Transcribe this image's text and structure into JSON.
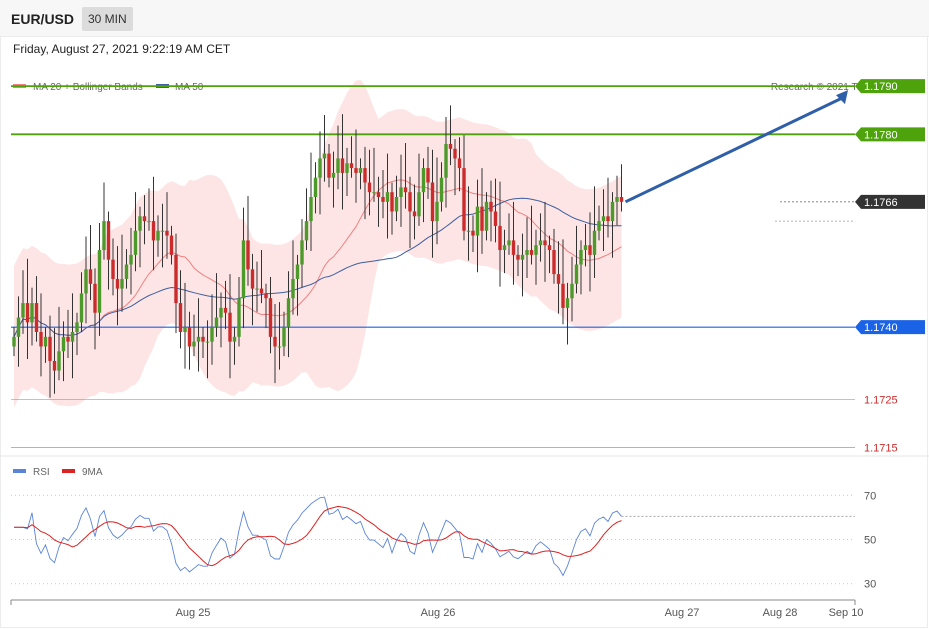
{
  "header": {
    "symbol": "EUR/USD",
    "timeframe": "30 MIN"
  },
  "datetime": "Friday, August 27, 2021 9:22:19 AM CET",
  "legend": {
    "ma20": {
      "label": "MA 20 + Bollinger Bands",
      "color": "#f08080"
    },
    "ma50": {
      "label": "MA 50",
      "color": "#3f5f9f"
    }
  },
  "copyright": "Research © 2021 Trading Central",
  "rsi_legend": {
    "rsi": {
      "label": "RSI",
      "color": "#5b84d8"
    },
    "ma9": {
      "label": "9MA",
      "color": "#dd2222"
    }
  },
  "colors": {
    "up": "#4c9a2a",
    "down": "#cc2b2b",
    "bands": "#fde2e2",
    "target": "#4ea30c",
    "support": "#1a63e6",
    "pivot": "#333333",
    "faint": "#e06060"
  },
  "chart_data": [
    {
      "type": "line",
      "subtype": "candlestick",
      "ylim": [
        1.1711,
        1.1795
      ],
      "x_labels": [
        "Aug 25",
        "Aug 26",
        "Aug 27",
        "Aug 28",
        "Sep 10"
      ],
      "levels": [
        {
          "value": 1.179,
          "label": "1.1790",
          "style": "target"
        },
        {
          "value": 1.178,
          "label": "1.1780",
          "style": "target"
        },
        {
          "value": 1.1766,
          "label": "1.1766",
          "style": "pivot"
        },
        {
          "value": 1.174,
          "label": "1.1740",
          "style": "support"
        },
        {
          "value": 1.1725,
          "label": "1.1725",
          "style": "faint"
        },
        {
          "value": 1.1715,
          "label": "1.1715",
          "style": "faint"
        }
      ],
      "forecast_arrow": {
        "from": 1.1766,
        "to": 1.179
      },
      "closes": [
        1.1738,
        1.1742,
        1.1745,
        1.1741,
        1.1745,
        1.1739,
        1.1736,
        1.1738,
        1.1733,
        1.1731,
        1.1735,
        1.1738,
        1.1737,
        1.1739,
        1.1741,
        1.1747,
        1.1752,
        1.1749,
        1.1743,
        1.1756,
        1.1762,
        1.1754,
        1.175,
        1.1748,
        1.175,
        1.1753,
        1.1755,
        1.176,
        1.1763,
        1.1762,
        1.1762,
        1.1758,
        1.176,
        1.176,
        1.1759,
        1.1755,
        1.1745,
        1.1739,
        1.174,
        1.1736,
        1.1737,
        1.1738,
        1.1737,
        1.1737,
        1.174,
        1.1742,
        1.1744,
        1.1743,
        1.1737,
        1.1738,
        1.1746,
        1.1758,
        1.1752,
        1.1748,
        1.1748,
        1.1747,
        1.1746,
        1.1738,
        1.1736,
        1.1736,
        1.174,
        1.1746,
        1.175,
        1.1753,
        1.1758,
        1.1762,
        1.1767,
        1.1771,
        1.1775,
        1.1776,
        1.1771,
        1.1772,
        1.1775,
        1.1772,
        1.1774,
        1.1773,
        1.1772,
        1.1773,
        1.177,
        1.1768,
        1.1768,
        1.1767,
        1.1766,
        1.1768,
        1.1764,
        1.1767,
        1.1769,
        1.1768,
        1.1764,
        1.1763,
        1.1768,
        1.1773,
        1.177,
        1.1762,
        1.1766,
        1.1771,
        1.1778,
        1.1777,
        1.1775,
        1.1773,
        1.176,
        1.176,
        1.1759,
        1.1765,
        1.176,
        1.1766,
        1.1764,
        1.1761,
        1.1756,
        1.1757,
        1.1758,
        1.1755,
        1.1754,
        1.1755,
        1.1756,
        1.1755,
        1.1757,
        1.1758,
        1.1757,
        1.1756,
        1.1751,
        1.1749,
        1.1744,
        1.1746,
        1.1749,
        1.1753,
        1.1756,
        1.1757,
        1.1755,
        1.176,
        1.1762,
        1.1763,
        1.1762,
        1.1766,
        1.1767,
        1.1766
      ]
    },
    {
      "type": "line",
      "ylim": [
        24,
        76
      ],
      "yticks": [
        70,
        50,
        30
      ],
      "series": [
        {
          "name": "RSI"
        },
        {
          "name": "9MA"
        }
      ]
    }
  ]
}
